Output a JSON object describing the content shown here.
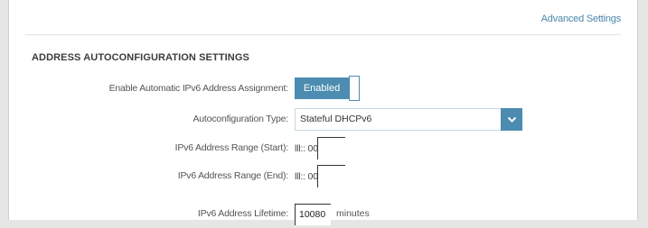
{
  "header": {
    "advanced_settings_link": "Advanced Settings"
  },
  "section": {
    "title": "ADDRESS AUTOCONFIGURATION SETTINGS"
  },
  "fields": {
    "enable_auto_ipv6": {
      "label": "Enable Automatic IPv6 Address Assignment:",
      "value": "Enabled"
    },
    "autoconfig_type": {
      "label": "Autoconfiguration Type:",
      "value": "Stateful DHCPv6"
    },
    "range_start": {
      "label": "IPv6 Address Range (Start):",
      "prefix": "lll:: 00"
    },
    "range_end": {
      "label": "IPv6 Address Range (End):",
      "prefix": "lll:: 00"
    },
    "lifetime": {
      "label": "IPv6 Address Lifetime:",
      "value": "10080",
      "units": "minutes"
    }
  },
  "colors": {
    "accent": "#4b8cb0",
    "link": "#4b86ac"
  },
  "icons": {
    "dropdown": "chevron-down-icon"
  }
}
